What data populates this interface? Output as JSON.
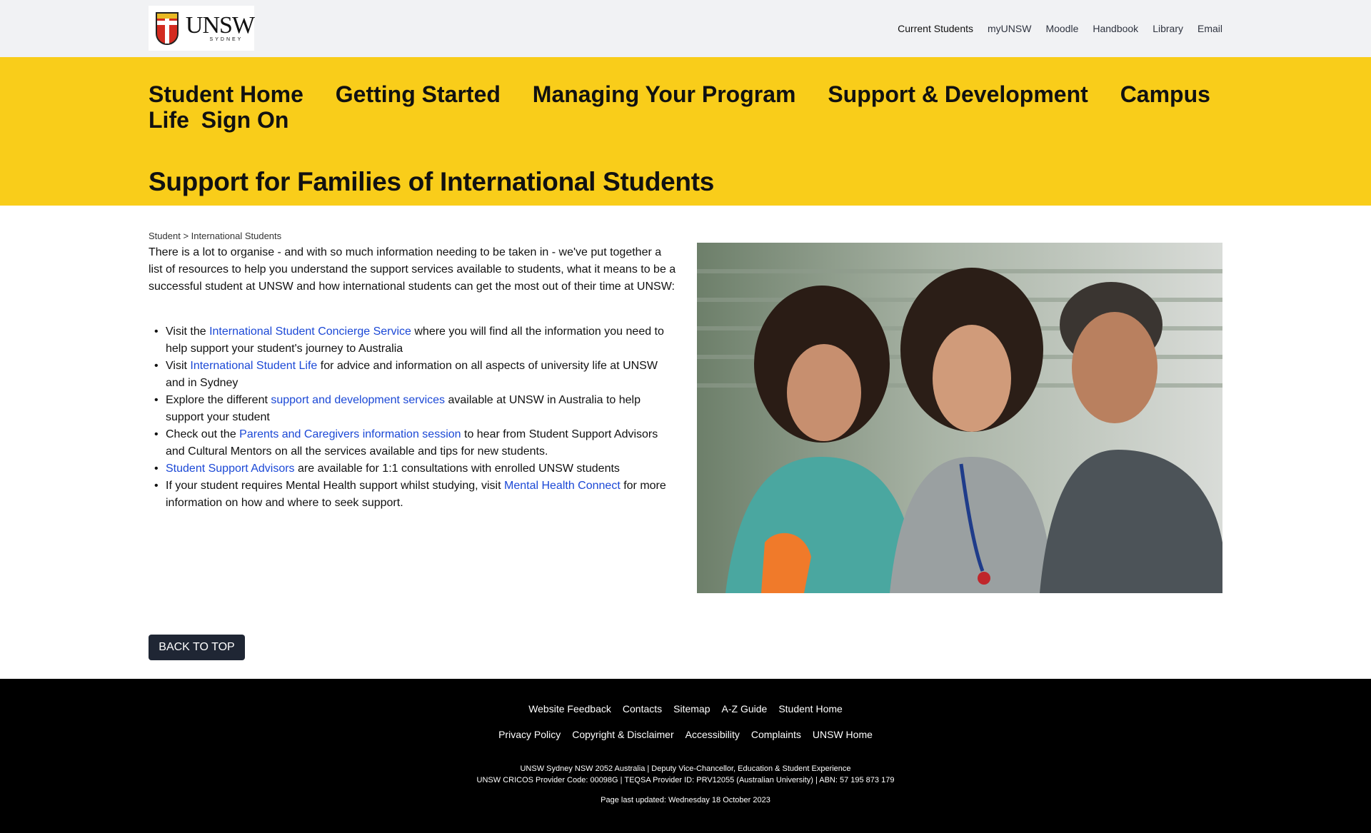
{
  "logo": {
    "text": "UNSW",
    "subtext": "SYDNEY"
  },
  "utility_nav": [
    "Current Students",
    "myUNSW",
    "Moodle",
    "Handbook",
    "Library",
    "Email"
  ],
  "main_nav": [
    "Student Home",
    "Getting Started",
    "Managing Your Program",
    "Support & Development",
    "Campus Life",
    "Sign On"
  ],
  "page_title": "Support for Families of International Students",
  "breadcrumb": {
    "root": "Student",
    "separator": ">",
    "current": "International Students"
  },
  "intro": "There is a lot to organise - and with so much information needing to be taken in - we've put together a list of resources to help you understand the support services available to students, what it means to be a successful student at UNSW and how international students can get the most out of their time at UNSW:",
  "resources": [
    {
      "before": "Visit the ",
      "link": "International Student Concierge Service",
      "after": " where you will find all the information you need to help support your student's journey to Australia"
    },
    {
      "before": "Visit ",
      "link": "International Student Life",
      "after": " for advice and information on all aspects of university life at UNSW and in Sydney"
    },
    {
      "before": "Explore the different ",
      "link": "support and development services",
      "after": " available at UNSW in Australia to help support your student"
    },
    {
      "before": "Check out the ",
      "link": "Parents and Caregivers information session",
      "after": " to hear from Student Support Advisors and Cultural Mentors on all the services available and tips for new students."
    },
    {
      "before": "",
      "link": "Student Support Advisors",
      "after": " are available for 1:1 consultations with enrolled UNSW students"
    },
    {
      "before": "If your student requires Mental Health support whilst studying, visit ",
      "link": "Mental Health Connect",
      "after": " for more information on how and where to seek support."
    }
  ],
  "back_to_top": "BACK TO TOP",
  "footer": {
    "row1": [
      "Website Feedback",
      "Contacts",
      "Sitemap",
      "A-Z Guide",
      "Student Home"
    ],
    "row2": [
      "Privacy Policy",
      "Copyright & Disclaimer",
      "Accessibility",
      "Complaints",
      "UNSW Home"
    ],
    "address": "UNSW Sydney NSW 2052 Australia | Deputy Vice-Chancellor, Education & Student Experience",
    "provider": "UNSW CRICOS Provider Code: 00098G | TEQSA Provider ID: PRV12055 (Australian University) | ABN: 57 195 873 179",
    "updated": "Page last updated: Wednesday 18 October 2023"
  }
}
